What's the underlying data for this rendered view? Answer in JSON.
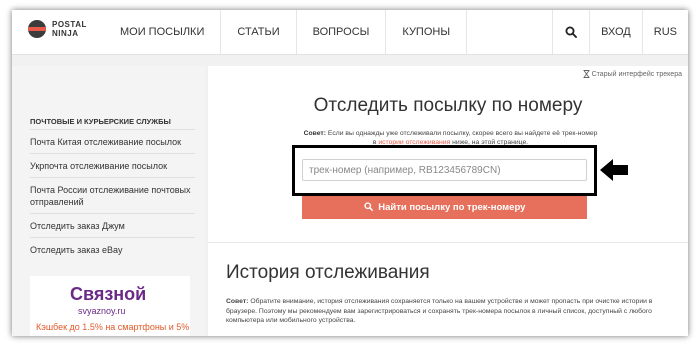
{
  "header": {
    "logo_line1": "POSTAL",
    "logo_line2": "NINJA",
    "nav": [
      "МОИ ПОСЫЛКИ",
      "СТАТЬИ",
      "ВОПРОСЫ",
      "КУПОНЫ"
    ],
    "login": "ВХОД",
    "lang": "RUS"
  },
  "old_ui_link": "Старый интерфейс трекера",
  "sidebar": {
    "title": "ПОЧТОВЫЕ И КУРЬЕРСКИЕ СЛУЖБЫ",
    "items": [
      "Почта Китая отслеживание посылок",
      "Укрпочта отслеживание посылок",
      "Почта России отслеживание почтовых отправлений",
      "Отследить заказ Джум",
      "Отследить заказ eBay"
    ]
  },
  "ad": {
    "brand": "Связной",
    "site": "svyaznoy.ru",
    "promo": "Кэшбек до 1.5% на смартфоны и 5%"
  },
  "main": {
    "title": "Отследить посылку по номеру",
    "tip_label": "Совет:",
    "tip_text": "Если вы однажды уже отслеживали посылку, скорее всего вы найдете её трек-номер в",
    "tip_link": "истории отслеживания",
    "tip_tail": "ниже, на этой странице.",
    "input_placeholder": "трек-номер (например, RB123456789CN)",
    "button_label": "Найти посылку по трек-номеру",
    "history_title": "История отслеживания",
    "history_tip_label": "Совет:",
    "history_tip_text": "Обратите внимание, история отслеживания сохраняется только на вашем устройстве и может пропасть при очистке истории в браузере. Поэтому мы рекомендуем вам зарегистрироваться и сохранять трек-номера посылок в личный список, доступный с любого компьютера или мобильного устройства."
  },
  "colors": {
    "accent": "#e7705c",
    "ad_brand": "#6b2a86"
  }
}
